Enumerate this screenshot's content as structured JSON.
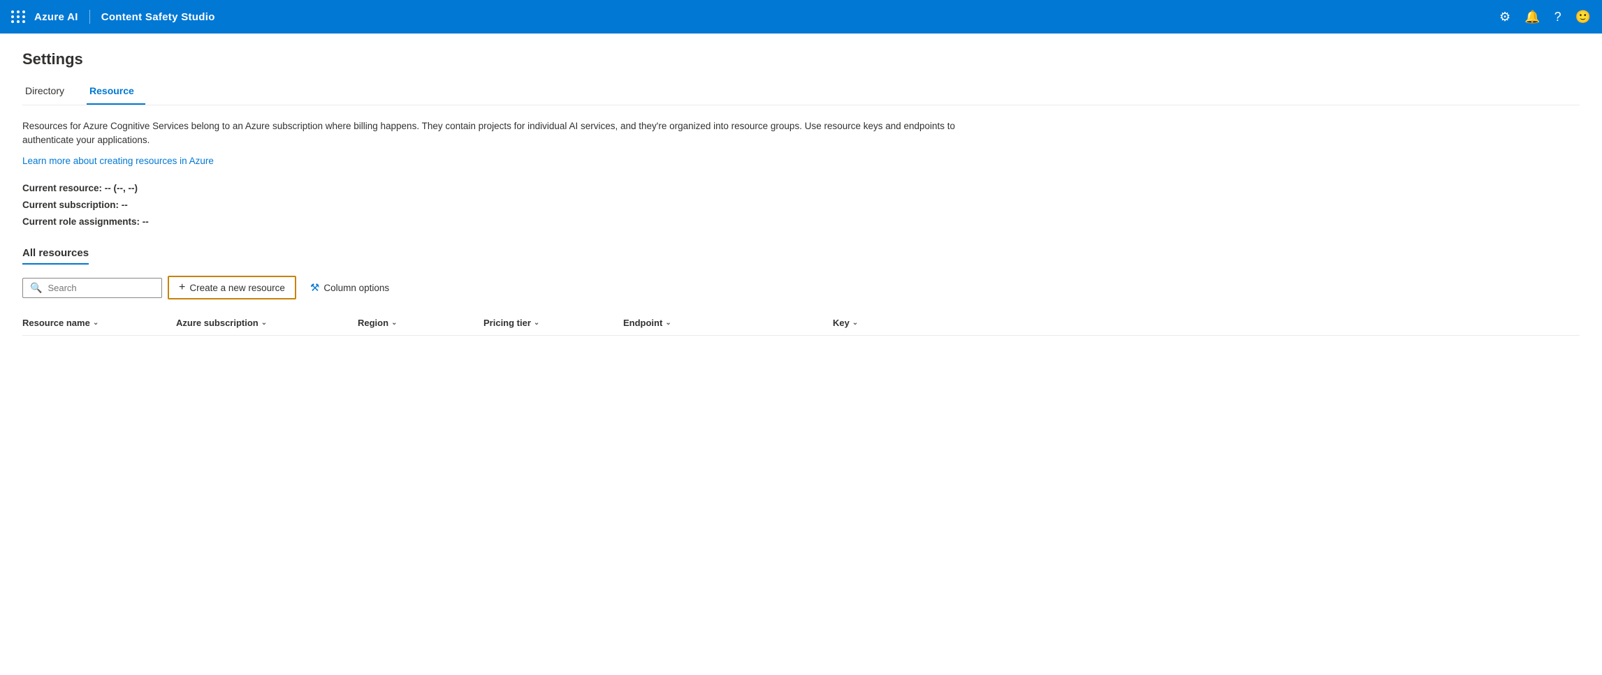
{
  "topnav": {
    "brand": "Azure AI",
    "divider": "|",
    "app_name": "Content Safety Studio",
    "icons": {
      "settings": "⚙",
      "notifications": "🔔",
      "help": "?",
      "account": "🙂"
    }
  },
  "page": {
    "title": "Settings",
    "tabs": [
      {
        "id": "directory",
        "label": "Directory",
        "active": false
      },
      {
        "id": "resource",
        "label": "Resource",
        "active": true
      }
    ],
    "description": "Resources for Azure Cognitive Services belong to an Azure subscription where billing happens. They contain projects for individual AI services, and they're organized into resource groups. Use resource keys and endpoints to authenticate your applications.",
    "learn_more_link": "Learn more about creating resources in Azure",
    "current_resource_label": "Current resource: -- (--, --)",
    "current_subscription_label": "Current subscription: --",
    "current_role_label": "Current role assignments: --",
    "section_title": "All resources",
    "search_placeholder": "Search",
    "create_button_label": "Create a new resource",
    "column_options_label": "Column options",
    "table_headers": [
      {
        "id": "resource_name",
        "label": "Resource name"
      },
      {
        "id": "azure_subscription",
        "label": "Azure subscription"
      },
      {
        "id": "region",
        "label": "Region"
      },
      {
        "id": "pricing_tier",
        "label": "Pricing tier"
      },
      {
        "id": "endpoint",
        "label": "Endpoint"
      },
      {
        "id": "key",
        "label": "Key"
      }
    ]
  },
  "colors": {
    "accent": "#0078d4",
    "nav_bg": "#0078d4",
    "create_border": "#c8820a"
  }
}
